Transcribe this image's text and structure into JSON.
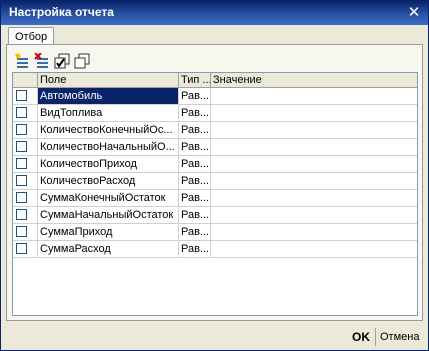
{
  "window": {
    "title": "Настройка отчета",
    "close_icon": "close-icon"
  },
  "tabs": [
    {
      "label": "Отбор",
      "active": true
    }
  ],
  "toolbar": {
    "buttons": [
      {
        "name": "add-filter-icon"
      },
      {
        "name": "delete-filter-icon"
      },
      {
        "name": "check-all-icon"
      },
      {
        "name": "copy-icon"
      }
    ]
  },
  "grid": {
    "columns": [
      "",
      "Поле",
      "Тип ...",
      "Значение"
    ],
    "rows": [
      {
        "field": "Автомобиль",
        "type": "Рав...",
        "value": "",
        "checked": false,
        "selected": true
      },
      {
        "field": "ВидТоплива",
        "type": "Рав...",
        "value": "",
        "checked": false
      },
      {
        "field": "КоличествоКонечныйОс...",
        "type": "Рав...",
        "value": "",
        "checked": false
      },
      {
        "field": "КоличествоНачальныйО...",
        "type": "Рав...",
        "value": "",
        "checked": false
      },
      {
        "field": "КоличествоПриход",
        "type": "Рав...",
        "value": "",
        "checked": false
      },
      {
        "field": "КоличествоРасход",
        "type": "Рав...",
        "value": "",
        "checked": false
      },
      {
        "field": "СуммаКонечныйОстаток",
        "type": "Рав...",
        "value": "",
        "checked": false
      },
      {
        "field": "СуммаНачальныйОстаток",
        "type": "Рав...",
        "value": "",
        "checked": false
      },
      {
        "field": "СуммаПриход",
        "type": "Рав...",
        "value": "",
        "checked": false
      },
      {
        "field": "СуммаРасход",
        "type": "Рав...",
        "value": "",
        "checked": false
      }
    ]
  },
  "footer": {
    "ok_label": "OK",
    "cancel_label": "Отмена"
  },
  "colors": {
    "title_bar": "#0a246a",
    "selection": "#0a246a",
    "window_bg": "#ece9d8"
  }
}
